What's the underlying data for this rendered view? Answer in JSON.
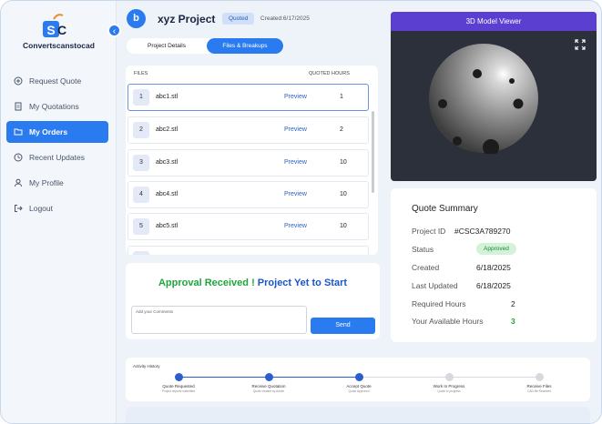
{
  "brand": "Convertscanstocad",
  "sidebar": {
    "items": [
      {
        "label": "Request Quote",
        "icon": "plus-circle-icon"
      },
      {
        "label": "My Quotations",
        "icon": "document-icon"
      },
      {
        "label": "My Orders",
        "icon": "folder-icon"
      },
      {
        "label": "Recent Updates",
        "icon": "clock-icon"
      },
      {
        "label": "My Profile",
        "icon": "user-icon"
      },
      {
        "label": "Logout",
        "icon": "logout-icon"
      }
    ]
  },
  "header": {
    "avatar_letter": "b",
    "title": "xyz Project",
    "badge": "Quoted",
    "created": "Created:6/17/2025"
  },
  "tabs": [
    {
      "label": "Project Details"
    },
    {
      "label": "Files & Breakups"
    }
  ],
  "files": {
    "col_files": "FILES",
    "col_hours": "QUOTED HOURS",
    "preview_label": "Preview",
    "rows": [
      {
        "num": "1",
        "name": "abc1.stl",
        "hours": "1"
      },
      {
        "num": "2",
        "name": "abc2.stl",
        "hours": "2"
      },
      {
        "num": "3",
        "name": "abc3.stl",
        "hours": "10"
      },
      {
        "num": "4",
        "name": "abc4.stl",
        "hours": "10"
      },
      {
        "num": "5",
        "name": "abc5.stl",
        "hours": "10"
      }
    ]
  },
  "approval": {
    "received": "Approval Received !",
    "status": "Project Yet to Start",
    "comment_placeholder": "Add your Comments",
    "send_label": "Send"
  },
  "viewer": {
    "title": "3D Model Viewer"
  },
  "summary": {
    "title": "Quote Summary",
    "rows": [
      {
        "label": "Project ID",
        "value": "#CSC3A789270"
      },
      {
        "label": "Status",
        "value": "Approved"
      },
      {
        "label": "Created",
        "value": "6/18/2025"
      },
      {
        "label": "Last Updated",
        "value": "6/18/2025"
      },
      {
        "label": "Required Hours",
        "value": "2"
      },
      {
        "label": "Your Available Hours",
        "value": "3"
      }
    ]
  },
  "activity": {
    "title": "Activity History",
    "steps": [
      {
        "label": "Quote Requested",
        "sub": "Project request submitted",
        "done": true
      },
      {
        "label": "Receive Quotation",
        "sub": "Quote created by Admin",
        "done": true
      },
      {
        "label": "Accept Quote",
        "sub": "Quote Approved",
        "done": true
      },
      {
        "label": "Work In Progress",
        "sub": "Quote in progress",
        "done": false
      },
      {
        "label": "Receive Files",
        "sub": "CAD file Received",
        "done": false
      }
    ]
  },
  "colors": {
    "accent": "#2b7bf0",
    "approved_green": "#1fa53c",
    "status_blue": "#1a56c9",
    "viewer_header": "#5a3fd0"
  }
}
